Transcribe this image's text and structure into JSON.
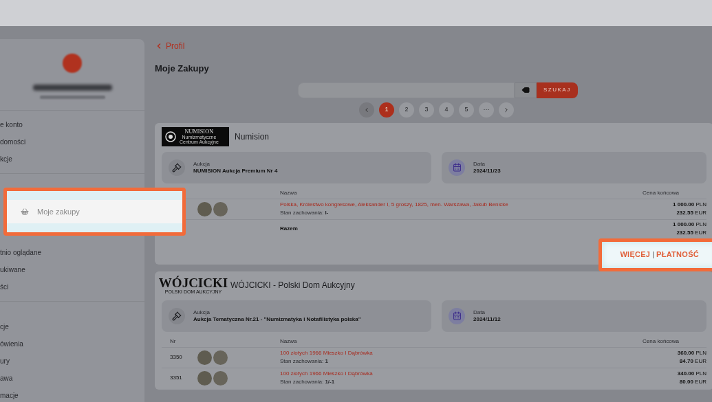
{
  "sidebar": {
    "sections": [
      {
        "items": [
          {
            "label": "e konto",
            "highlighted": false
          },
          {
            "label": "domości",
            "highlighted": false
          },
          {
            "label": "kcje",
            "highlighted": false
          }
        ]
      },
      {
        "items": [
          {
            "label": "Moje zakupy",
            "highlighted": true
          },
          {
            "label": "tnio oglądane",
            "highlighted": false
          },
          {
            "label": "ukiwane",
            "highlighted": false
          },
          {
            "label": "ści",
            "highlighted": false
          }
        ]
      },
      {
        "items": [
          {
            "label": "cje",
            "highlighted": false
          },
          {
            "label": "ówienia",
            "highlighted": false
          },
          {
            "label": "ury",
            "highlighted": false
          },
          {
            "label": "awa",
            "highlighted": false
          },
          {
            "label": "macje",
            "highlighted": false
          }
        ]
      }
    ]
  },
  "back_link": "Profil",
  "title": "Moje Zakupy",
  "search": {
    "button": "SZUKAJ"
  },
  "pagination": [
    {
      "label": "1",
      "selected": true
    },
    {
      "label": "2",
      "selected": false
    },
    {
      "label": "3",
      "selected": false
    },
    {
      "label": "4",
      "selected": false
    },
    {
      "label": "5",
      "selected": false
    },
    {
      "label": "···",
      "selected": false
    }
  ],
  "purchases": [
    {
      "logo": {
        "kind": "numision",
        "lines": [
          "NUMISION",
          "Numizmatyczne",
          "Centrum Aukcyjne"
        ]
      },
      "house": "Numision",
      "auction_label": "Aukcja",
      "auction": "NUMISION Aukcja Premium Nr 4",
      "date_label": "Data",
      "date": "2024/11/23",
      "columns": {
        "name": "Nazwa",
        "price": "Cena końcowa"
      },
      "rows": [
        {
          "name": "Polska, Królestwo kongresowe, Aleksander I, 5 groszy, 1825, men. Warszawa, Jakub Benicke",
          "condition": "Stan zachowania: **I-**",
          "pln": "**1 000.00** PLN",
          "eur": "**232.55** EUR"
        }
      ],
      "total": {
        "label": "Razem",
        "pln": "**1 000.00** PLN",
        "eur": "**232.55** EUR"
      },
      "actions": {
        "more": "WIĘCEJ",
        "separator": "|",
        "pay": "PŁATNOŚĆ",
        "highlighted": true
      }
    },
    {
      "logo": {
        "kind": "wojcicki",
        "lines": [
          "WÓJCICKI",
          "POLSKI DOM AUKCYJNY"
        ]
      },
      "house": "WÓJCICKI - Polski Dom Aukcyjny",
      "auction_label": "Aukcja",
      "auction": "Aukcja Tematyczna Nr.21 - \"Numizmatyka i Notafilistyka polska\"",
      "date_label": "Data",
      "date": "2024/11/12",
      "columns": {
        "nr": "Nr",
        "name": "Nazwa",
        "price": "Cena końcowa"
      },
      "rows": [
        {
          "nr": "3350",
          "name": "100 złotych 1966 Mieszko I Dąbrówka",
          "condition": "Stan zachowania: **1**",
          "pln": "**360.00** PLN",
          "eur": "**84.70** EUR"
        },
        {
          "nr": "3351",
          "name": "100 złotych 1966 Mieszko I Dąbrówka",
          "condition": "Stan zachowania: **1/-1**",
          "pln": "**340.00** PLN",
          "eur": "**80.00** EUR"
        }
      ]
    }
  ]
}
